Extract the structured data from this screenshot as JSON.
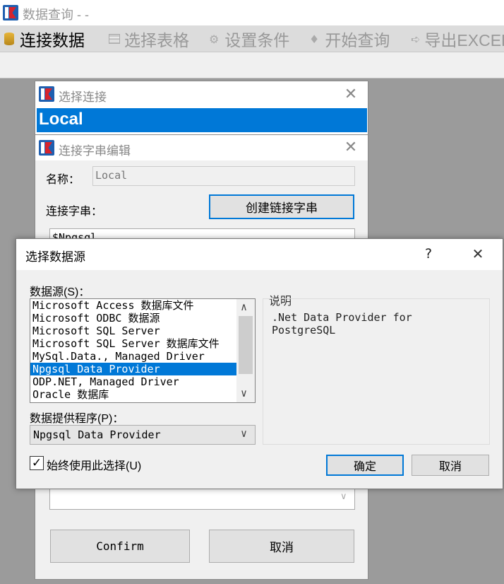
{
  "app": {
    "title": "数据查询 - -",
    "menu": [
      {
        "icon": "database-icon",
        "label": "连接数据"
      },
      {
        "icon": "table-icon",
        "label": "选择表格"
      },
      {
        "icon": "gear-icon",
        "label": "设置条件"
      },
      {
        "icon": "pin-icon",
        "label": "开始查询"
      },
      {
        "icon": "export-icon",
        "label": "导出EXCEL"
      }
    ]
  },
  "select_conn": {
    "title": "选择连接",
    "selected": "Local"
  },
  "conn_edit": {
    "title": "连接字串编辑",
    "name_label": "名称：",
    "name_value": "Local",
    "conn_label": "连接字串：",
    "create_button": "创建链接字串",
    "conn_value": "$Npgsql",
    "confirm_button": "Confirm",
    "cancel_button": "取消"
  },
  "datasource": {
    "title": "选择数据源",
    "help": "?",
    "list_label": "数据源(S)：",
    "items": [
      "Microsoft Access 数据库文件",
      "Microsoft ODBC 数据源",
      "Microsoft SQL Server",
      "Microsoft SQL Server 数据库文件",
      "MySql.Data., Managed Driver",
      "Npgsql Data Provider",
      "ODP.NET, Managed Driver",
      "Oracle 数据库"
    ],
    "provider_label": "数据提供程序(P)：",
    "provider_value": "Npgsql Data Provider",
    "desc_label": "说明",
    "desc_text": ".Net Data Provider for PostgreSQL",
    "always_label": "始终使用此选择(U)",
    "ok_button": "确定",
    "cancel_button": "取消"
  }
}
